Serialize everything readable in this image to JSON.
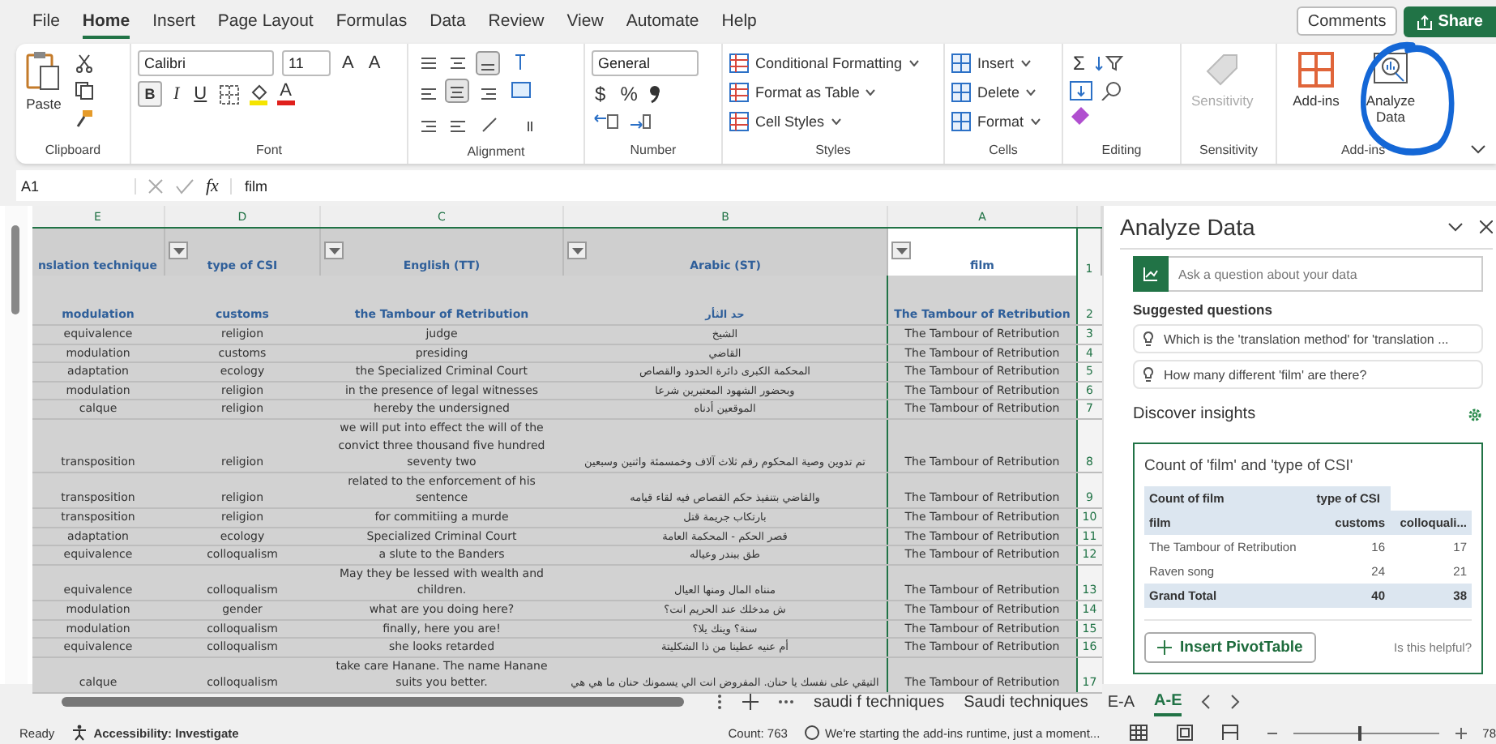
{
  "menu": [
    {
      "label": "File",
      "selected": false
    },
    {
      "label": "Home",
      "selected": true
    },
    {
      "label": "Insert",
      "selected": false
    },
    {
      "label": "Page Layout",
      "selected": false
    },
    {
      "label": "Formulas",
      "selected": false
    },
    {
      "label": "Data",
      "selected": false
    },
    {
      "label": "Review",
      "selected": false
    },
    {
      "label": "View",
      "selected": false
    },
    {
      "label": "Automate",
      "selected": false
    },
    {
      "label": "Help",
      "selected": false
    }
  ],
  "header_buttons": {
    "comments": "Comments",
    "share": "Share"
  },
  "ribbon": {
    "clipboard": {
      "paste": "Paste",
      "label": "Clipboard"
    },
    "font": {
      "family": "Calibri",
      "size": "11",
      "grow": "A",
      "shrink": "A",
      "bold": "B",
      "italic": "I",
      "underline": "U",
      "font_color_letter": "A",
      "label": "Font"
    },
    "alignment": {
      "label": "Alignment"
    },
    "number": {
      "format": "General",
      "currency": "$",
      "percent": "%",
      "label": "Number"
    },
    "styles": {
      "items": [
        "Conditional Formatting",
        "Format as Table",
        "Cell Styles"
      ],
      "label": "Styles"
    },
    "cells": {
      "items": [
        "Insert",
        "Delete",
        "Format"
      ],
      "label": "Cells"
    },
    "editing": {
      "sum": "Σ",
      "label": "Editing"
    },
    "sensitivity": {
      "button": "Sensitivity",
      "disabled": true,
      "label": "Sensitivity"
    },
    "addins": {
      "buttons": [
        "Add-ins",
        "Analyze Data"
      ],
      "label": "Add-ins"
    }
  },
  "formula_bar": {
    "name_box": "A1",
    "fx": "fx",
    "value": "film"
  },
  "sheet": {
    "columns": [
      {
        "letter": "E",
        "header": "nslation technique",
        "filter": false
      },
      {
        "letter": "D",
        "header": "type of CSI",
        "filter": true
      },
      {
        "letter": "C",
        "header": "English (TT)",
        "filter": true
      },
      {
        "letter": "B",
        "header": "Arabic (ST)",
        "filter": true
      },
      {
        "letter": "A",
        "header": "film",
        "filter": true
      }
    ],
    "header_row": "1",
    "rows": [
      {
        "number": "2",
        "bold": true,
        "cells": [
          "modulation",
          "customs",
          "the Tambour of Retribution",
          "حد الثأر",
          "The Tambour of Retribution"
        ]
      },
      {
        "number": "3",
        "bold": false,
        "cells": [
          "equivalence",
          "religion",
          "judge",
          "الشيخ",
          "The Tambour of Retribution"
        ]
      },
      {
        "number": "4",
        "bold": false,
        "cells": [
          "modulation",
          "customs",
          "presiding",
          "القاضي",
          "The Tambour of Retribution"
        ]
      },
      {
        "number": "5",
        "bold": false,
        "cells": [
          "adaptation",
          "ecology",
          "the Specialized Criminal Court",
          "المحكمة الكبرى دائرة الحدود والقصاص",
          "The Tambour of Retribution"
        ]
      },
      {
        "number": "6",
        "bold": false,
        "cells": [
          "modulation",
          "religion",
          "in the presence of legal witnesses",
          "وبحضور الشهود المعتبرين شرعا",
          "The Tambour of Retribution"
        ]
      },
      {
        "number": "7",
        "bold": false,
        "cells": [
          "calque",
          "religion",
          "hereby the undersigned",
          "الموقعين أدناه",
          "The Tambour of Retribution"
        ]
      },
      {
        "number": "8",
        "bold": false,
        "cells": [
          "transposition",
          "religion",
          "we will put into effect the will of the convict three thousand five hundred seventy two",
          "تم تدوين وصية المحكوم رقم ثلاث آلاف وخمسمئة واثنين وسبعين",
          "The Tambour of Retribution"
        ]
      },
      {
        "number": "9",
        "bold": false,
        "cells": [
          "transposition",
          "religion",
          "related to the enforcement of his sentence",
          "والقاضي بتنفيذ حكم القصاص فيه لقاء قيامه",
          "The Tambour of Retribution"
        ]
      },
      {
        "number": "10",
        "bold": false,
        "cells": [
          "transposition",
          "religion",
          "for commitiing a murde",
          "بارتكاب جريمة قتل",
          "The Tambour of Retribution"
        ]
      },
      {
        "number": "11",
        "bold": false,
        "cells": [
          "adaptation",
          "ecology",
          "Specialized Criminal Court",
          "قصر الحكم - المحكمة العامة",
          "The Tambour of Retribution"
        ]
      },
      {
        "number": "12",
        "bold": false,
        "cells": [
          "equivalence",
          "colloqualism",
          "a slute to the Banders",
          "طق ببندر وعياله",
          "The Tambour of Retribution"
        ]
      },
      {
        "number": "13",
        "bold": false,
        "cells": [
          "equivalence",
          "colloqualism",
          "May they be lessed with wealth and children.",
          "منناه المال ومنها العيال",
          "The Tambour of Retribution"
        ]
      },
      {
        "number": "14",
        "bold": false,
        "cells": [
          "modulation",
          "gender",
          "what are you doing here?",
          "ش مدخلك عند الحريم انت؟",
          "The Tambour of Retribution"
        ]
      },
      {
        "number": "15",
        "bold": false,
        "cells": [
          "modulation",
          "colloqualism",
          "finally, here you are!",
          "سنة؟ وينك يلا؟",
          "The Tambour of Retribution"
        ]
      },
      {
        "number": "16",
        "bold": false,
        "cells": [
          "equivalence",
          "colloqualism",
          "she looks retarded",
          "أم عنيه عطينا من ذا الشكليتة",
          "The Tambour of Retribution"
        ]
      },
      {
        "number": "17",
        "bold": false,
        "cells": [
          "calque",
          "colloqualism",
          "take care Hanane. The name Hanane suits you better.",
          "التيقي على نفسك يا حنان. المفروض انت الي يسمونك حنان ما هي هي",
          "The Tambour of Retribution"
        ]
      }
    ]
  },
  "sheet_tabs": [
    {
      "label": "saudi f techniques",
      "selected": false
    },
    {
      "label": "Saudi techniques",
      "selected": false
    },
    {
      "label": "E-A",
      "selected": false
    },
    {
      "label": "A-E",
      "selected": true
    }
  ],
  "pane": {
    "title": "Analyze Data",
    "ask_placeholder": "Ask a question about your data",
    "suggested_title": "Suggested questions",
    "suggestions": [
      "Which is the 'translation method' for 'translation ...",
      "How many different 'film' are there?"
    ],
    "insights_title": "Discover insights",
    "card": {
      "title": "Count of 'film' and 'type of CSI'",
      "rows": [
        {
          "kind": "header",
          "cells": [
            "Count of film",
            "type of CSI"
          ]
        },
        {
          "kind": "header",
          "cells": [
            "film",
            "customs",
            "colloquali..."
          ]
        },
        {
          "kind": "body",
          "cells": [
            "The Tambour of Retribution",
            "16",
            "17"
          ]
        },
        {
          "kind": "body",
          "cells": [
            "Raven song",
            "24",
            "21"
          ]
        },
        {
          "kind": "total",
          "cells": [
            "Grand Total",
            "40",
            "38"
          ]
        }
      ],
      "insert_button": "Insert PivotTable",
      "feedback": "Is this helpful?"
    }
  },
  "status_bar": {
    "mode": "Ready",
    "accessibility": "Accessibility: Investigate",
    "count": "Count: 763",
    "message": "We're starting the add-ins runtime, just a moment...",
    "zoom_slider": {
      "level": 0.45
    },
    "zoom": "78"
  }
}
